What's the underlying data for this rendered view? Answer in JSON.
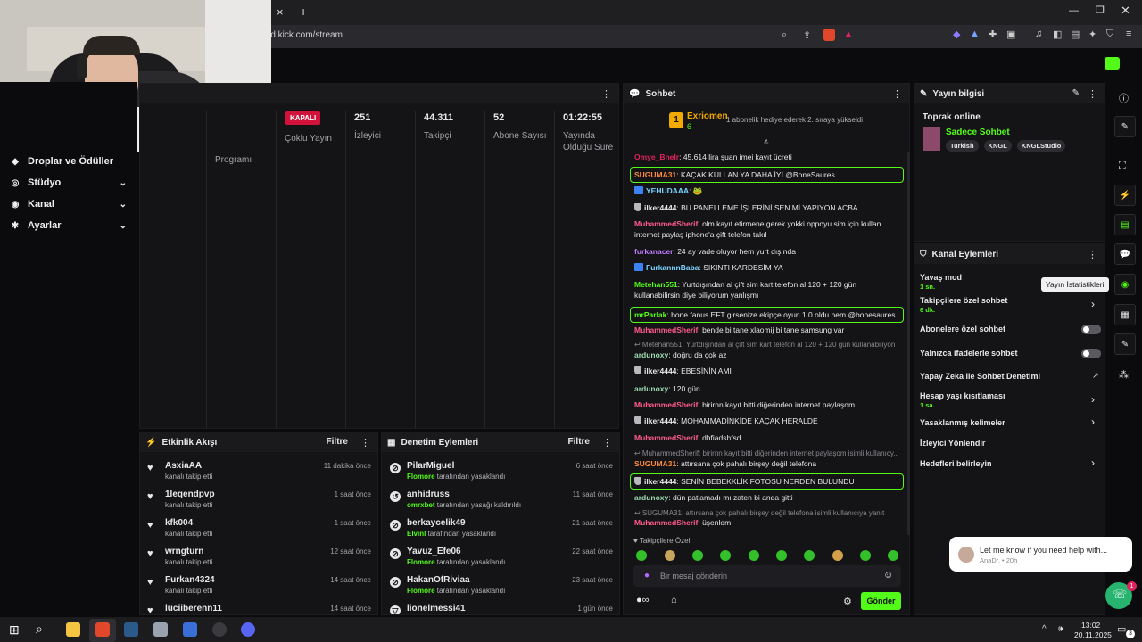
{
  "browser": {
    "url": "rd.kick.com/stream",
    "close_tab": "×",
    "new_tab": "+"
  },
  "nav": {
    "items": [
      {
        "icon": "◆",
        "label": "Droplar ve Ödüller"
      },
      {
        "icon": "◎",
        "label": "Stüdyo"
      },
      {
        "icon": "◉",
        "label": "Kanal"
      },
      {
        "icon": "✱",
        "label": "Ayarlar"
      }
    ]
  },
  "stats": {
    "programi": "Programı",
    "kapali": "KAPALI",
    "coklu": "Çoklu Yayın",
    "izleyici_val": "251",
    "izleyici": "İzleyici",
    "takipci_val": "44.311",
    "takipci": "Takipçi",
    "abone_val": "52",
    "abone": "Abone Sayısı",
    "sure_val": "01:22:55",
    "sure": "Yayında Olduğu Süre"
  },
  "activity": {
    "title": "Etkinlik Akışı",
    "filter": "Filtre",
    "rows": [
      {
        "name": "AsxiaAA",
        "sub": "kanalı takip etti",
        "time": "11 dakika önce"
      },
      {
        "name": "1leqendpvp",
        "sub": "kanalı takip etti",
        "time": "1 saat önce"
      },
      {
        "name": "kfk004",
        "sub": "kanalı takip etti",
        "time": "1 saat önce"
      },
      {
        "name": "wrngturn",
        "sub": "kanalı takip etti",
        "time": "12 saat önce"
      },
      {
        "name": "Furkan4324",
        "sub": "kanalı takip etti",
        "time": "14 saat önce"
      },
      {
        "name": "luciiberenn11",
        "sub": "",
        "time": "14 saat önce"
      }
    ]
  },
  "moderation": {
    "title": "Denetim Eylemleri",
    "filter": "Filtre",
    "rows": [
      {
        "name": "PilarMiguel",
        "by": "Flomore",
        "sub": "tarafından yasaklandı",
        "time": "6 saat önce"
      },
      {
        "name": "anhidruss",
        "by": "omrxbet",
        "sub": "tarafından yasağı kaldırıldı",
        "time": "11 saat önce"
      },
      {
        "name": "berkaycelik49",
        "by": "Elvinl",
        "sub": "tarafından yasaklandı",
        "time": "21 saat önce"
      },
      {
        "name": "Yavuz_Efe06",
        "by": "Flomore",
        "sub": "tarafından yasaklandı",
        "time": "22 saat önce"
      },
      {
        "name": "HakanOfRiviaa",
        "by": "Flomore",
        "sub": "tarafından yasaklandı",
        "time": "23 saat önce"
      },
      {
        "name": "lionelmessi41",
        "by": "",
        "sub": "",
        "time": "1 gün önce"
      }
    ]
  },
  "chat": {
    "title": "Sohbet",
    "pinned_user": "Exriomen",
    "pinned_count": "6",
    "pinned_text": "1 abonelik hediye ederek 2. sıraya yükseldi",
    "messages": [
      {
        "user": "Omye_Bnelr",
        "text": "45.614 lira şuan imei kayıt ücreti",
        "color": "#e0245e",
        "type": "normal"
      },
      {
        "user": "SUGUMA31",
        "text": "KAÇAK KULLAN YA DAHA İYİ @BoneSaures",
        "color": "#ff8a3d",
        "type": "hl"
      },
      {
        "user": "YEHUDAAA",
        "text": "🐸",
        "color": "#7ad4ff",
        "type": "badge"
      },
      {
        "user": "ilker4444",
        "text": "BU PANELLEME İŞLERİNİ SEN Mİ YAPIYON ACBA",
        "color": "#e8e8ea",
        "type": "mod"
      },
      {
        "user": "MuhammedSherif",
        "text": "olm kayıt etirmene gerek yokki oppoyu sim için kullan internet paylaş iphone'a çift telefon takıl",
        "color": "#ff5b8c",
        "type": "normal"
      },
      {
        "user": "furkanacer",
        "text": "24 ay vade oluyor hem yurt dışında",
        "color": "#c07bff",
        "type": "normal"
      },
      {
        "user": "FurkannnBaba",
        "text": "SIKINTI KARDESİM YA",
        "color": "#7ad4ff",
        "type": "badge"
      },
      {
        "user": "Metehan551",
        "text": "Yurtdışından al çift sim kart telefon al 120 + 120 gün kullanabilirsin diye biliyorum yanlışmı",
        "color": "#53fc18",
        "type": "normal"
      },
      {
        "user": "mrParlak",
        "text": "bone fanus EFT girsenize ekipçe oyun 1.0 oldu hem @bonesaures",
        "color": "#53fc18",
        "type": "hl"
      },
      {
        "user": "MuhammedSherif",
        "text": "bende bi tane xlaomij bi tane samsung var",
        "color": "#ff5b8c",
        "type": "normal"
      },
      {
        "user": "",
        "text": "↩ Metehan551: Yurtdışından al çift sim kart telefon al 120 + 120 gün kullanabiliyon di...",
        "color": "",
        "type": "reply"
      },
      {
        "user": "ardunoxy",
        "text": "doğru da çok az",
        "color": "#9bd9b0",
        "type": "normal"
      },
      {
        "user": "ilker4444",
        "text": "EBESİNİN AMI",
        "color": "#e8e8ea",
        "type": "mod"
      },
      {
        "user": "ardunoxy",
        "text": "120 gün",
        "color": "#9bd9b0",
        "type": "normal"
      },
      {
        "user": "MuhammedSherif",
        "text": "birirnn kayıt bitti diğerinden internet paylaşom",
        "color": "#ff5b8c",
        "type": "normal"
      },
      {
        "user": "ilker4444",
        "text": "MOHAMMADİNKİDE KAÇAK HERALDE",
        "color": "#e8e8ea",
        "type": "mod"
      },
      {
        "user": "MuhammedSherif",
        "text": "dhfiadshfsd",
        "color": "#ff5b8c",
        "type": "normal"
      },
      {
        "user": "",
        "text": "↩ MuhammedSherif: birirnn kayıt bitti diğerinden internet paylaşom isimli kullanıcy...",
        "color": "",
        "type": "reply"
      },
      {
        "user": "SUGUMA31",
        "text": "attırsana çok pahalı birşey değil telefona",
        "color": "#ff8a3d",
        "type": "normal"
      },
      {
        "user": "ilker4444",
        "text": "SENİN BEBEKKLİK FOTOSU NERDEN BULUNDU @BONESAURES",
        "color": "#e8e8ea",
        "type": "hlmod"
      },
      {
        "user": "ardunoxy",
        "text": "dün patlamadı mı zaten bi anda gitti",
        "color": "#9bd9b0",
        "type": "normal"
      },
      {
        "user": "",
        "text": "↩ SUGUMA31: attırsana çok pahalı birşey değil telefona isimli kullanıcıya yanıt veriyor",
        "color": "",
        "type": "reply"
      },
      {
        "user": "MuhammedSherif",
        "text": "üşenlom",
        "color": "#ff5b8c",
        "type": "normal"
      }
    ],
    "followers_only": "Takipçilere Özel",
    "input_placeholder": "Bir mesaj gönderin",
    "send": "Gönder"
  },
  "stream_info": {
    "title": "Yayın bilgisi",
    "stream_title": "Toprak online",
    "category": "Sadece Sohbet",
    "tags": [
      "Turkish",
      "KNGL",
      "KNGLStudio"
    ]
  },
  "channel_actions": {
    "title": "Kanal Eylemleri",
    "items": [
      {
        "label": "Yavaş mod",
        "sub": "1 sn.",
        "control": "none"
      },
      {
        "label": "Takipçilere özel sohbet",
        "sub": "6 dk.",
        "control": "chevron"
      },
      {
        "label": "Abonelere özel sohbet",
        "sub": "",
        "control": "toggle"
      },
      {
        "label": "Yalnızca ifadelerle sohbet",
        "sub": "",
        "control": "toggle"
      },
      {
        "label": "Yapay Zeka ile Sohbet Denetimi",
        "sub": "",
        "control": "external"
      },
      {
        "label": "Hesap yaşı kısıtlaması",
        "sub": "1 sa.",
        "control": "chevron"
      },
      {
        "label": "Yasaklanmış kelimeler",
        "sub": "",
        "control": "chevron"
      },
      {
        "label": "İzleyici Yönlendir",
        "sub": "",
        "control": "none"
      },
      {
        "label": "Hedefleri belirleyin",
        "sub": "",
        "control": "chevron"
      }
    ]
  },
  "tooltip": "Yayın İstatistikleri",
  "help": {
    "text": "Let me know if you need help with...",
    "meta": "AnaDr. • 20h",
    "count": "1"
  },
  "taskbar": {
    "time": "13:02",
    "date": "20.11.2025",
    "notif": "3"
  },
  "colors": {
    "accent": "#53fc18",
    "live_red": "#d3123b"
  }
}
